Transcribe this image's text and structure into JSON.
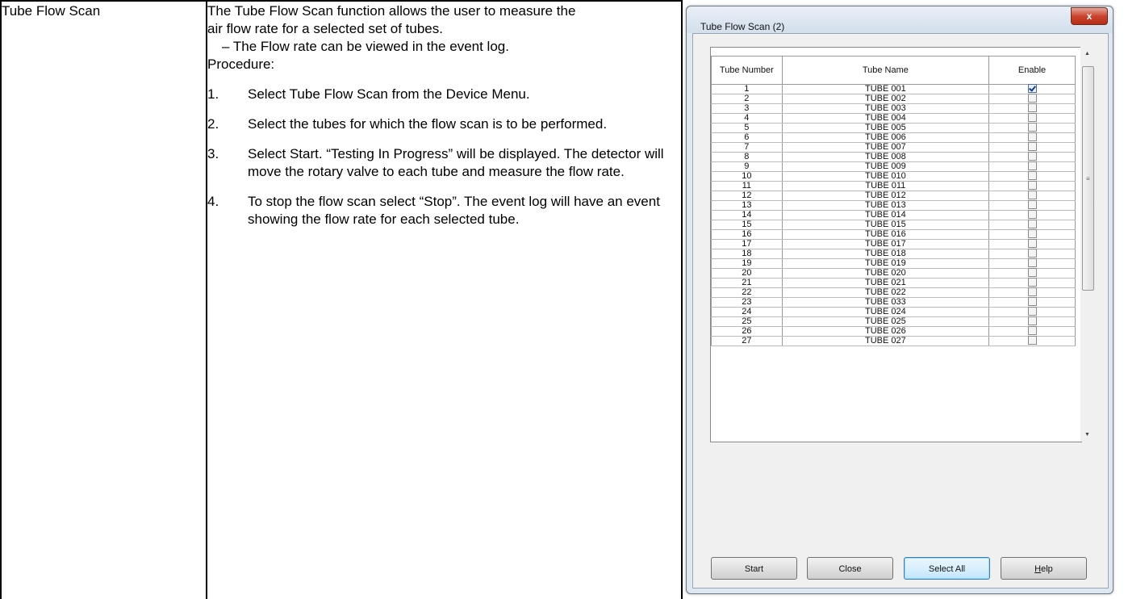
{
  "doc": {
    "label": "Tube Flow Scan",
    "desc_line1": "The Tube Flow Scan function allows the user to measure the",
    "desc_line2": "air flow rate for a selected set of tubes.",
    "desc_line3": "– The Flow rate can be viewed in the event log.",
    "procedure": "Procedure:",
    "steps": [
      {
        "num": "1.",
        "text": "Select Tube Flow Scan from the Device Menu."
      },
      {
        "num": "2.",
        "text": "Select the tubes for which the flow scan is to be performed."
      },
      {
        "num": "3.",
        "text": "Select Start. “Testing In Progress” will be displayed. The detector will move the rotary valve to each tube and measure the flow rate."
      },
      {
        "num": "4.",
        "text": "To stop the flow scan select “Stop”. The event log will have an event showing the flow rate for each selected tube."
      }
    ]
  },
  "dialog": {
    "title": "Tube Flow Scan (2)",
    "close_glyph": "x",
    "columns": [
      "Tube Number",
      "Tube Name",
      "Enable"
    ],
    "rows": [
      {
        "num": "1",
        "name": "TUBE 001",
        "enabled": true
      },
      {
        "num": "2",
        "name": "TUBE 002",
        "enabled": false
      },
      {
        "num": "3",
        "name": "TUBE 003",
        "enabled": false
      },
      {
        "num": "4",
        "name": "TUBE 004",
        "enabled": false
      },
      {
        "num": "5",
        "name": "TUBE 005",
        "enabled": false
      },
      {
        "num": "6",
        "name": "TUBE 006",
        "enabled": false
      },
      {
        "num": "7",
        "name": "TUBE 007",
        "enabled": false
      },
      {
        "num": "8",
        "name": "TUBE 008",
        "enabled": false
      },
      {
        "num": "9",
        "name": "TUBE 009",
        "enabled": false
      },
      {
        "num": "10",
        "name": "TUBE 010",
        "enabled": false
      },
      {
        "num": "11",
        "name": "TUBE 011",
        "enabled": false
      },
      {
        "num": "12",
        "name": "TUBE 012",
        "enabled": false
      },
      {
        "num": "13",
        "name": "TUBE 013",
        "enabled": false
      },
      {
        "num": "14",
        "name": "TUBE 014",
        "enabled": false
      },
      {
        "num": "15",
        "name": "TUBE 015",
        "enabled": false
      },
      {
        "num": "16",
        "name": "TUBE 016",
        "enabled": false
      },
      {
        "num": "17",
        "name": "TUBE 017",
        "enabled": false
      },
      {
        "num": "18",
        "name": "TUBE 018",
        "enabled": false
      },
      {
        "num": "19",
        "name": "TUBE 019",
        "enabled": false
      },
      {
        "num": "20",
        "name": "TUBE 020",
        "enabled": false
      },
      {
        "num": "21",
        "name": "TUBE 021",
        "enabled": false
      },
      {
        "num": "22",
        "name": "TUBE 022",
        "enabled": false
      },
      {
        "num": "23",
        "name": "TUBE 033",
        "enabled": false
      },
      {
        "num": "24",
        "name": "TUBE 024",
        "enabled": false
      },
      {
        "num": "25",
        "name": "TUBE 025",
        "enabled": false
      },
      {
        "num": "26",
        "name": "TUBE 026",
        "enabled": false
      },
      {
        "num": "27",
        "name": "TUBE 027",
        "enabled": false
      }
    ],
    "buttons": {
      "start": "Start",
      "close": "Close",
      "select_all": "Select All",
      "help": "Help"
    },
    "scroll": {
      "up_glyph": "▲",
      "down_glyph": "▼",
      "grip_glyph": "≡"
    }
  }
}
